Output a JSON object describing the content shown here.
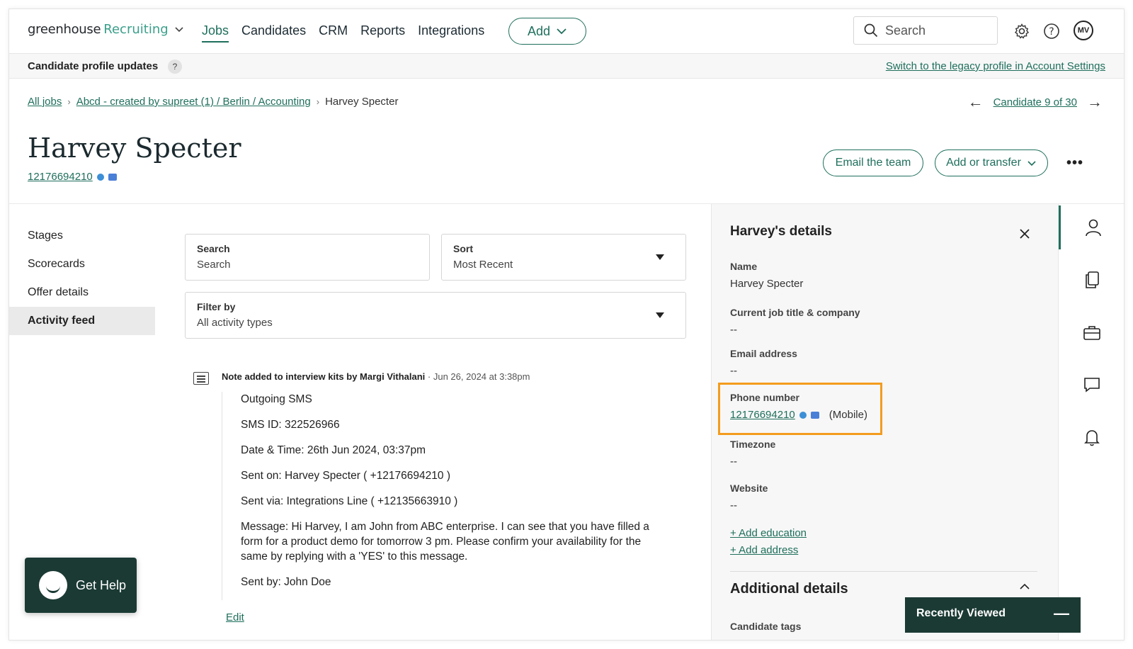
{
  "nav": {
    "logo_main": "greenhouse",
    "logo_product": "Recruiting",
    "links": [
      "Jobs",
      "Candidates",
      "CRM",
      "Reports",
      "Integrations"
    ],
    "add_label": "Add",
    "search_placeholder": "Search",
    "avatar_initials": "MV"
  },
  "subbar": {
    "title": "Candidate profile updates",
    "help": "?",
    "legacy_link": "Switch to the legacy profile in Account Settings"
  },
  "breadcrumb": {
    "all_jobs": "All jobs",
    "job": "Abcd - created by supreet (1) / Berlin / Accounting",
    "current": "Harvey Specter"
  },
  "candidate_nav": {
    "label": "Candidate 9 of 30"
  },
  "candidate": {
    "name": "Harvey Specter",
    "phone": "12176694210"
  },
  "actions": {
    "email_team": "Email the team",
    "add_transfer": "Add or transfer",
    "more": "•••"
  },
  "leftnav": {
    "items": [
      "Stages",
      "Scorecards",
      "Offer details",
      "Activity feed"
    ]
  },
  "feed": {
    "search_label": "Search",
    "search_placeholder": "Search",
    "sort_label": "Sort",
    "sort_value": "Most Recent",
    "filter_label": "Filter by",
    "filter_value": "All activity types",
    "note": {
      "header": "Note added to interview kits by Margi Vithalani",
      "separator": "·",
      "date": "Jun 26, 2024 at 3:38pm",
      "lines": [
        "Outgoing SMS",
        "SMS ID: 322526966",
        "Date & Time: 26th Jun 2024, 03:37pm",
        "Sent on: Harvey Specter ( +12176694210 )",
        "Sent via: Integrations Line ( +12135663910 )",
        "Message: Hi Harvey, I am John from ABC enterprise. I can see that you have filled a form for a product demo for tomorrow 3 pm. Please confirm your availability for the same by replying with a 'YES' to this message.",
        "Sent by: John Doe"
      ],
      "edit": "Edit"
    }
  },
  "details": {
    "title": "Harvey's details",
    "name_label": "Name",
    "name_value": "Harvey Specter",
    "job_label": "Current job title & company",
    "job_value": "--",
    "email_label": "Email address",
    "email_value": "--",
    "phone_label": "Phone number",
    "phone_value": "12176694210",
    "phone_type": "(Mobile)",
    "timezone_label": "Timezone",
    "timezone_value": "--",
    "website_label": "Website",
    "website_value": "--",
    "add_education": "+ Add education",
    "add_address": "+ Add address",
    "additional_title": "Additional details",
    "tags_label": "Candidate tags"
  },
  "recently_viewed": {
    "label": "Recently Viewed"
  },
  "help_widget": {
    "label": "Get Help"
  },
  "colors": {
    "accent": "#1f6f5c",
    "highlight": "#f39c1e",
    "dark": "#1b3a34"
  }
}
